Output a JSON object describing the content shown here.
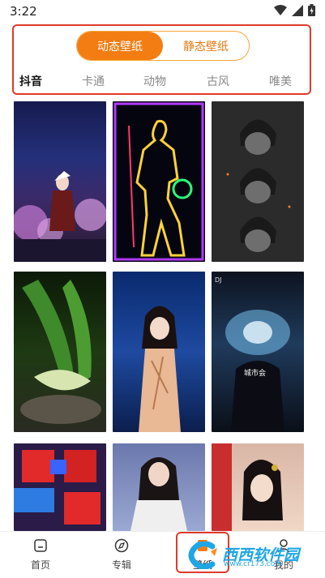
{
  "status_bar": {
    "time": "3:22"
  },
  "header": {
    "tabs": [
      {
        "label": "动态壁纸",
        "active": true
      },
      {
        "label": "静态壁纸",
        "active": false
      }
    ],
    "categories": [
      {
        "label": "抖音",
        "active": true
      },
      {
        "label": "卡通",
        "active": false
      },
      {
        "label": "动物",
        "active": false
      },
      {
        "label": "古风",
        "active": false
      },
      {
        "label": "唯美",
        "active": false
      }
    ]
  },
  "wallpapers": [
    {
      "name": "anime-warrior-flowers"
    },
    {
      "name": "neon-basketball-player"
    },
    {
      "name": "anime-boy-repeating"
    },
    {
      "name": "cabbage-closeup"
    },
    {
      "name": "woman-qipao"
    },
    {
      "name": "dj-club",
      "caption_top": "DJ",
      "caption_mid": "城市会"
    },
    {
      "name": "red-blue-boxes"
    },
    {
      "name": "woman-white-dress"
    },
    {
      "name": "hanfu-woman"
    }
  ],
  "bottom_nav": {
    "items": [
      {
        "label": "首页",
        "icon": "home-icon"
      },
      {
        "label": "专辑",
        "icon": "album-icon"
      },
      {
        "label": "壁纸",
        "icon": "wallpaper-icon"
      },
      {
        "label": "我的",
        "icon": "profile-icon"
      }
    ]
  },
  "watermark": {
    "text": "西西软件园",
    "site": "www.cr173.com"
  },
  "colors": {
    "accent": "#f37d12",
    "highlight_border": "#e03a2a"
  }
}
